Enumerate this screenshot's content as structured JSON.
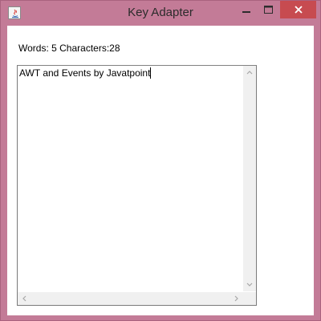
{
  "window": {
    "title": "Key Adapter",
    "icon": "java-app-icon",
    "controls": [
      "minimize-icon",
      "maximize-icon",
      "close-icon"
    ]
  },
  "counter": {
    "text": "Words: 5 Characters:28"
  },
  "textarea": {
    "value": "AWT and Events by Javatpoint"
  },
  "colors": {
    "frame": "#c37b97",
    "close_button": "#c74b50",
    "client_background": "#ffffff",
    "scrollbar_track": "#f0f0f0"
  }
}
